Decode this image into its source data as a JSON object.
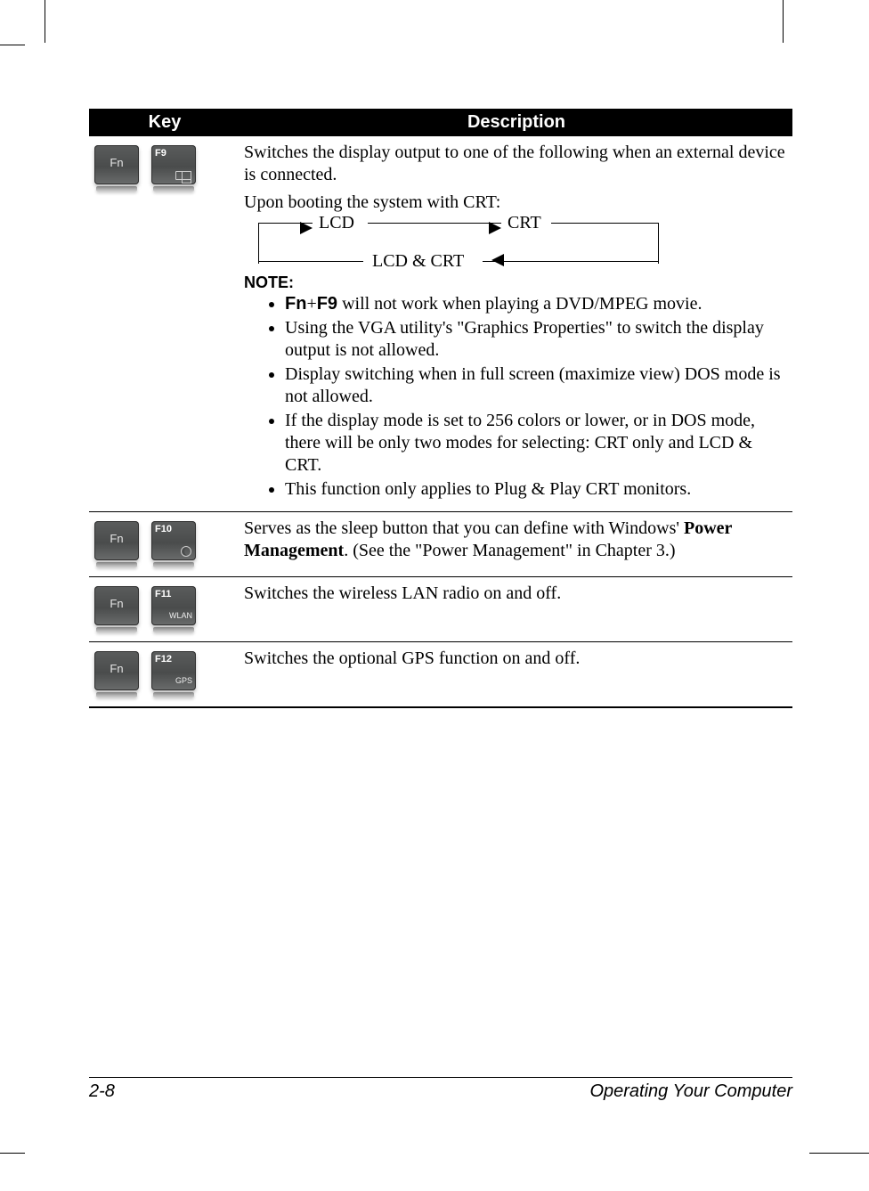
{
  "header": {
    "key": "Key",
    "desc": "Description"
  },
  "rows": {
    "f9": {
      "fn": "Fn",
      "fkey": "F9",
      "p1": "Switches the display output to one of the following when an external device is connected.",
      "p2": "Upon booting the system with CRT:",
      "cycle": {
        "lcd": "LCD",
        "crt": "CRT",
        "both": "LCD & CRT"
      },
      "note_label": "NOTE:",
      "notes": {
        "n1a": "Fn",
        "n1b": "+",
        "n1c": "F9",
        "n1d": " will not work when playing a DVD/MPEG movie.",
        "n2": "Using the VGA utility's \"Graphics Properties\" to switch the display output is not allowed.",
        "n3": "Display switching when in full screen (maximize view) DOS mode is not allowed.",
        "n4": "If the display mode is set to 256 colors or lower, or in DOS mode, there will be only two modes for selecting: CRT only and LCD & CRT.",
        "n5": "This function only applies to Plug & Play CRT monitors."
      }
    },
    "f10": {
      "fn": "Fn",
      "fkey": "F10",
      "t1": "Serves as the sleep button that you can define with Windows' ",
      "t2": "Power Management",
      "t3": ". (See the \"Power Management\" in Chapter 3.)"
    },
    "f11": {
      "fn": "Fn",
      "fkey": "F11",
      "sub": "WLAN",
      "text": "Switches the wireless LAN radio on and off."
    },
    "f12": {
      "fn": "Fn",
      "fkey": "F12",
      "sub": "GPS",
      "text": "Switches the optional GPS function on and off."
    }
  },
  "footer": {
    "left": "2-8",
    "right": "Operating Your Computer"
  }
}
